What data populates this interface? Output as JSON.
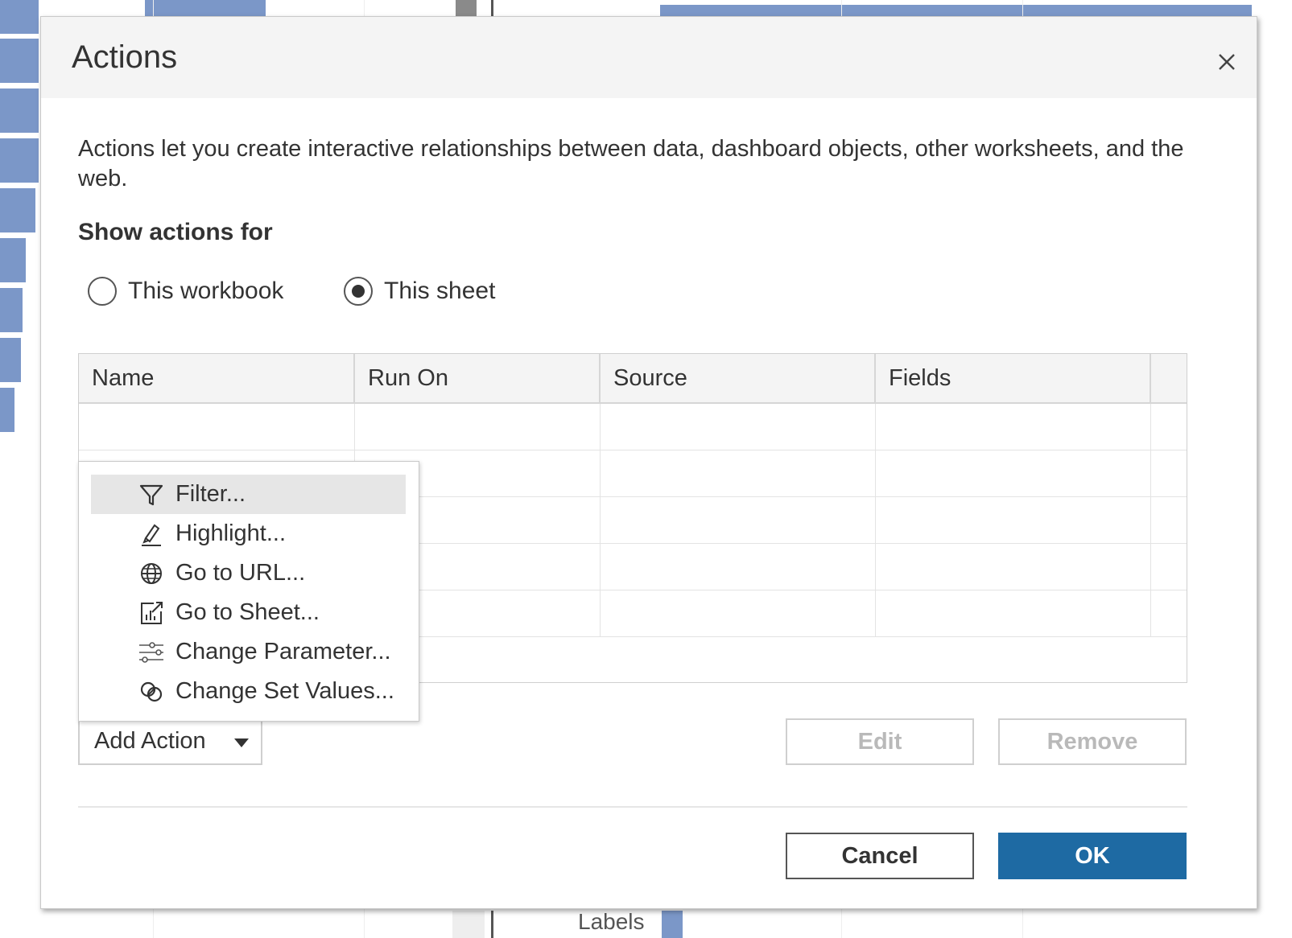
{
  "background": {
    "axis_label": "Labels"
  },
  "dialog": {
    "title": "Actions",
    "description": "Actions let you create interactive relationships between data, dashboard objects, other worksheets, and the web.",
    "show_actions_label": "Show actions for",
    "radios": [
      {
        "label": "This workbook",
        "selected": false
      },
      {
        "label": "This sheet",
        "selected": true
      }
    ],
    "table": {
      "columns": [
        "Name",
        "Run On",
        "Source",
        "Fields"
      ],
      "rows": []
    },
    "add_action": {
      "label": "Add Action",
      "menu_items": [
        {
          "label": "Filter...",
          "icon": "filter-icon",
          "highlighted": true
        },
        {
          "label": "Highlight...",
          "icon": "highlighter-icon",
          "highlighted": false
        },
        {
          "label": "Go to URL...",
          "icon": "globe-icon",
          "highlighted": false
        },
        {
          "label": "Go to Sheet...",
          "icon": "go-to-sheet-icon",
          "highlighted": false
        },
        {
          "label": "Change Parameter...",
          "icon": "sliders-icon",
          "highlighted": false
        },
        {
          "label": "Change Set Values...",
          "icon": "set-values-icon",
          "highlighted": false
        }
      ]
    },
    "buttons": {
      "edit": "Edit",
      "remove": "Remove",
      "cancel": "Cancel",
      "ok": "OK"
    }
  },
  "colors": {
    "accent": "#1e6aa3",
    "background_bars": "#7b97c8",
    "header_bg": "#f4f4f4"
  }
}
